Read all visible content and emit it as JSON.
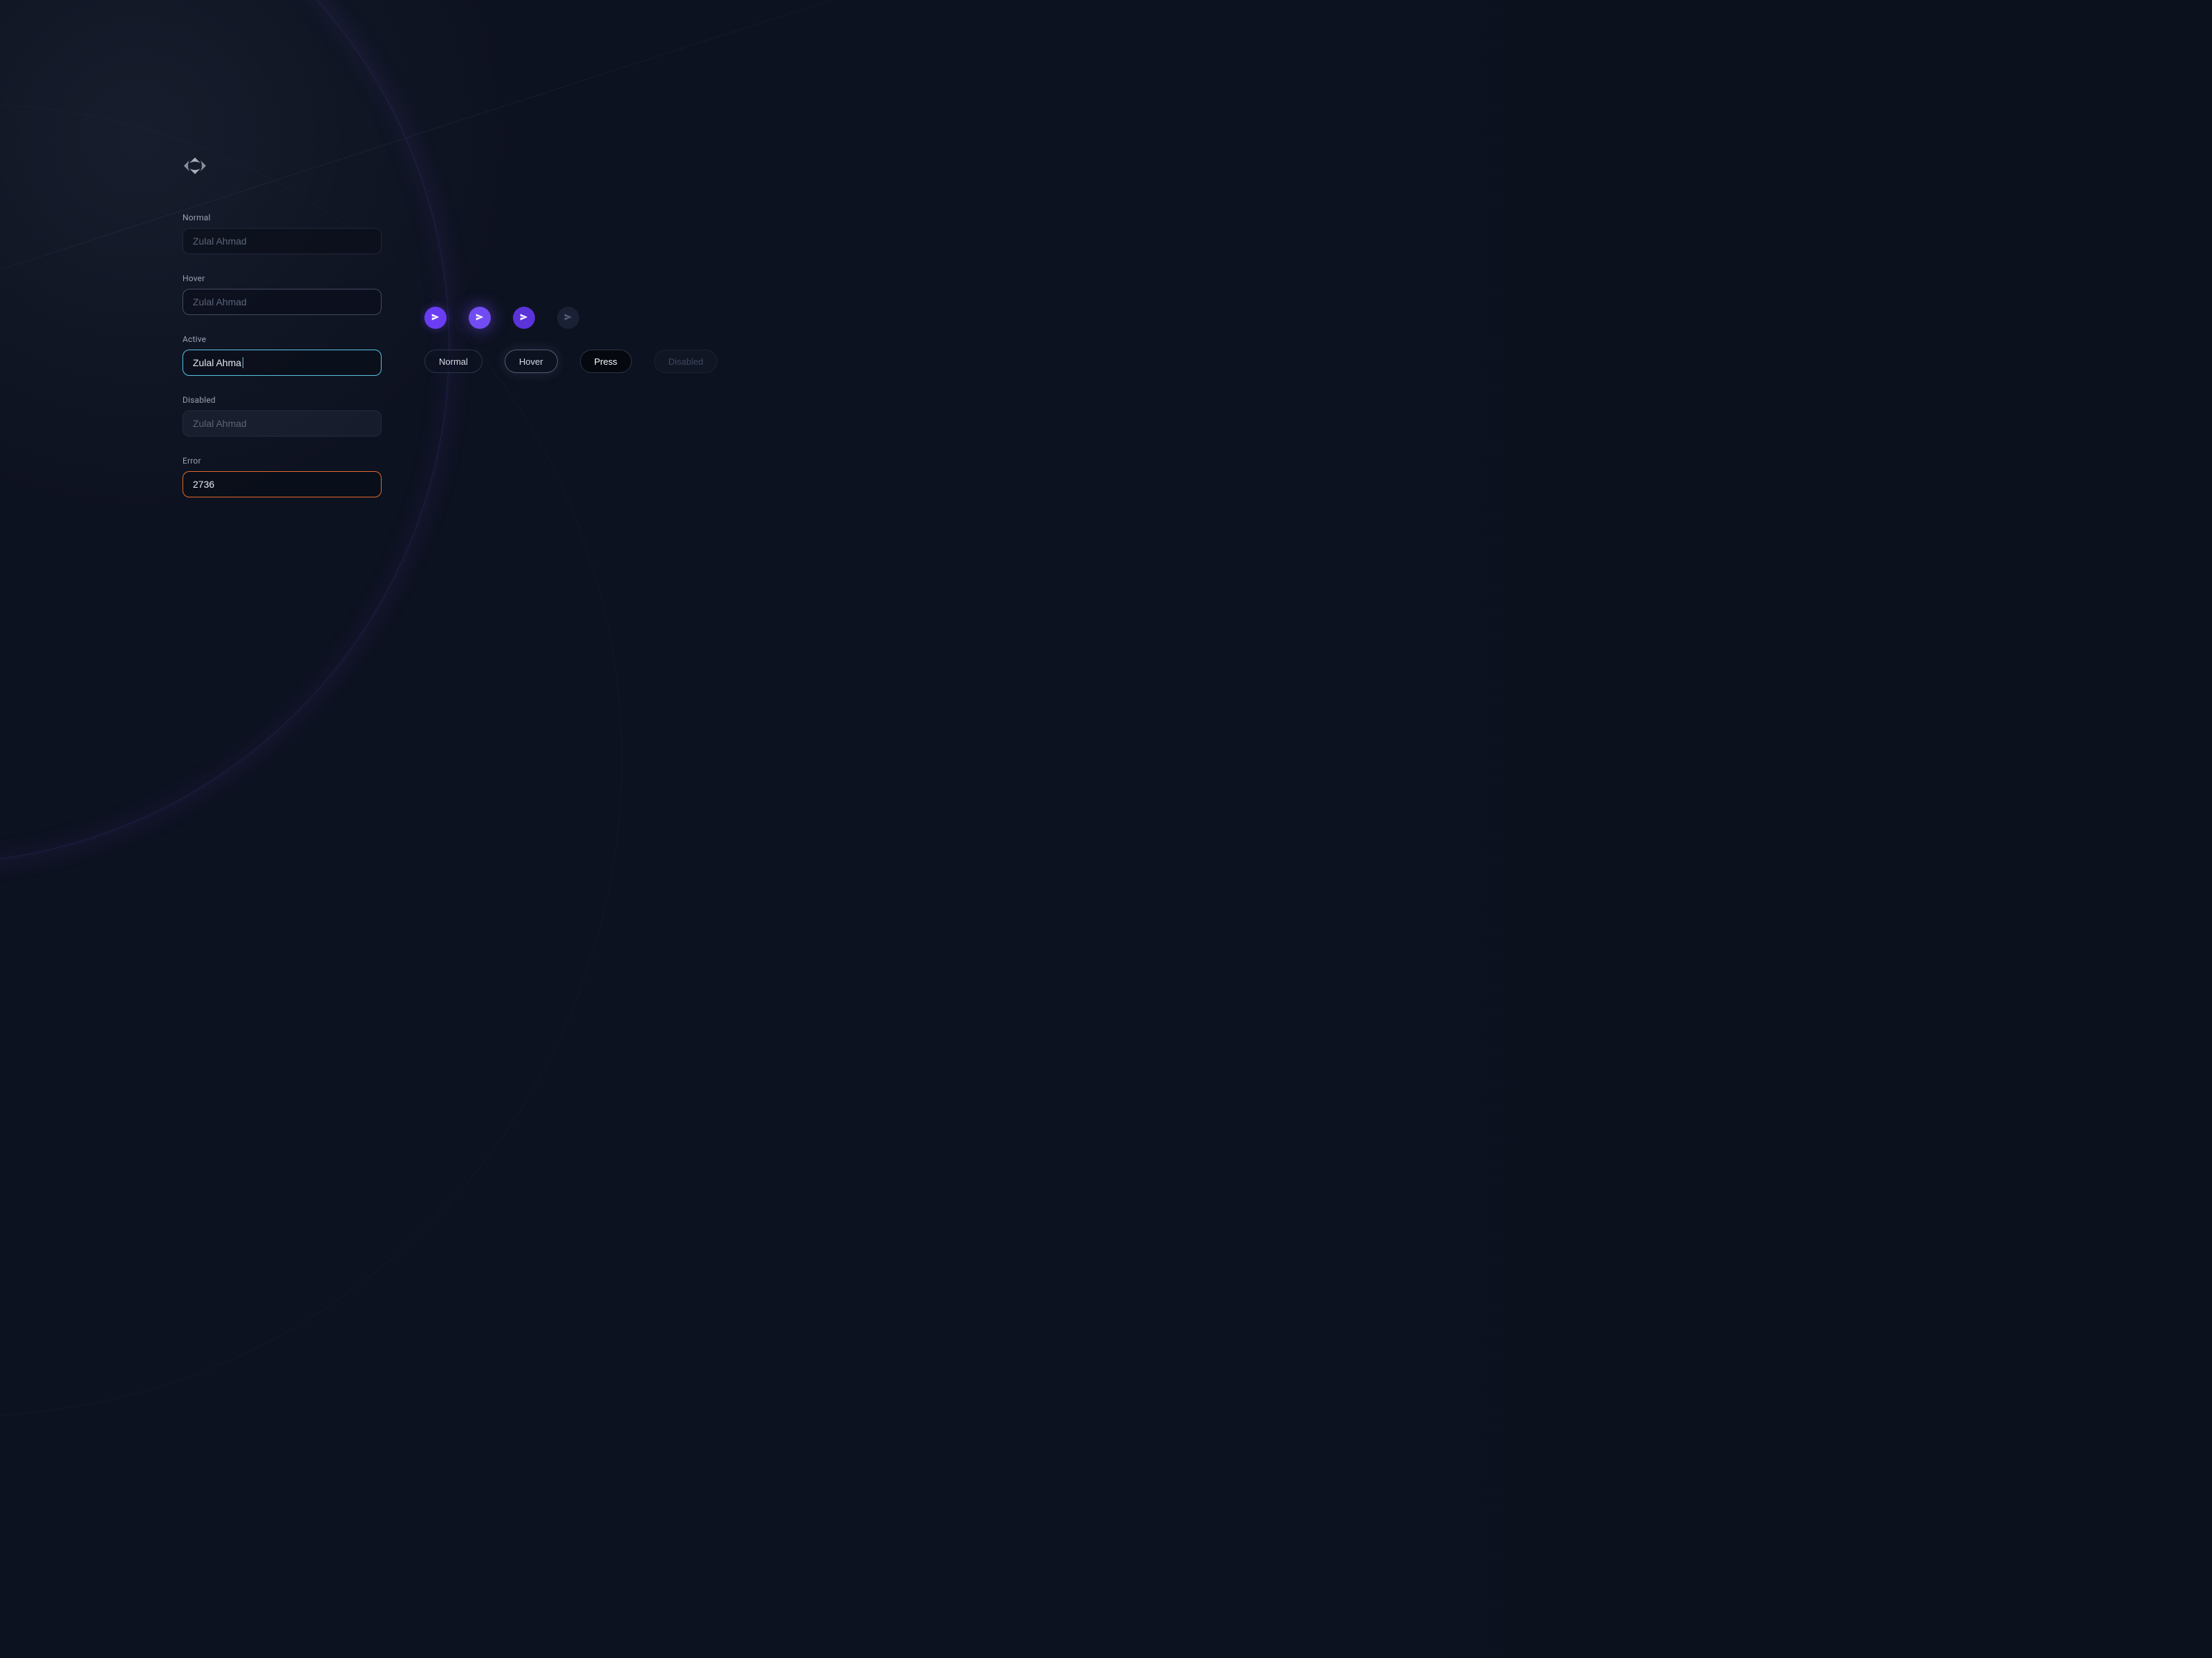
{
  "colors": {
    "accent_purple": "#6a3df5",
    "accent_cyan": "#58c4e6",
    "error_orange": "#e26a2c",
    "bg": "#0d1220"
  },
  "inputs": {
    "normal": {
      "label": "Normal",
      "placeholder": "Zulal Ahmad"
    },
    "hover": {
      "label": "Hover",
      "placeholder": "Zulal Ahmad"
    },
    "active": {
      "label": "Active",
      "value": "Zulal Ahma"
    },
    "disabled": {
      "label": "Disabled",
      "placeholder": "Zulal Ahmad"
    },
    "error": {
      "label": "Error",
      "value": "2736"
    }
  },
  "icon_buttons": {
    "icon": "send-icon",
    "states": [
      "normal",
      "hover",
      "press",
      "disabled"
    ]
  },
  "pill_buttons": {
    "normal": "Normal",
    "hover": "Hover",
    "press": "Press",
    "disabled": "Disabled"
  }
}
